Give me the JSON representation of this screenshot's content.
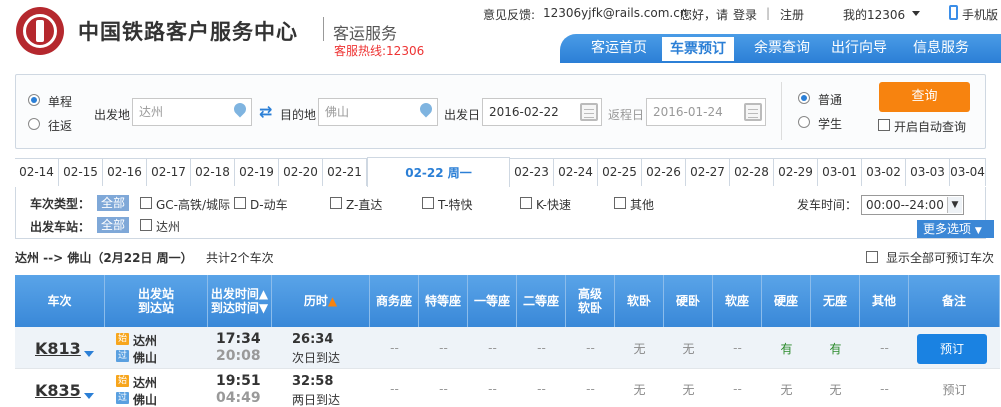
{
  "header": {
    "site_title": "中国铁路客户服务中心",
    "site_subtitle": "客运服务",
    "hotline": "客服热线:12306",
    "feedback_label": "意见反馈:",
    "feedback_email": "12306yjfk@rails.com.cn",
    "greeting": "您好，请",
    "login": "登录",
    "divider": "|",
    "register": "注册",
    "my12306": "我的12306",
    "mobile": "手机版"
  },
  "nav": [
    "客运首页",
    "车票预订",
    "余票查询",
    "出行向导",
    "信息服务"
  ],
  "nav_active": 1,
  "search": {
    "trip_oneway": "单程",
    "trip_round": "往返",
    "from_label": "出发地",
    "from_value": "达州",
    "to_label": "目的地",
    "to_value": "佛山",
    "depart_label": "出发日",
    "depart_value": "2016-02-22",
    "return_label": "返程日",
    "return_value": "2016-01-24",
    "passenger_normal": "普通",
    "passenger_student": "学生",
    "query_button": "查询",
    "auto_query": "开启自动查询"
  },
  "date_tabs": [
    "02-14",
    "02-15",
    "02-16",
    "02-17",
    "02-18",
    "02-19",
    "02-20",
    "02-21",
    "02-22 周一",
    "02-23",
    "02-24",
    "02-25",
    "02-26",
    "02-27",
    "02-28",
    "02-29",
    "03-01",
    "03-02",
    "03-03",
    "03-04"
  ],
  "date_active": 8,
  "filter": {
    "type_label": "车次类型：",
    "all": "全部",
    "types": [
      "GC-高铁/城际",
      "D-动车",
      "Z-直达",
      "T-特快",
      "K-快速",
      "其他"
    ],
    "station_label": "出发车站：",
    "stations": [
      "达州"
    ],
    "time_label": "发车时间：",
    "time_value": "00:00--24:00",
    "more": "更多选项"
  },
  "summary": {
    "route": "达州 --> 佛山（2月22日  周一）",
    "count": "共计2个车次",
    "show_all": "显示全部可预订车次"
  },
  "table": {
    "headers": [
      "车次",
      "出发站\n到达站",
      "出发时间▲\n到达时间▼",
      "历时",
      "商务座",
      "特等座",
      "一等座",
      "二等座",
      "高级\n软卧",
      "软卧",
      "硬卧",
      "软座",
      "硬座",
      "无座",
      "其他",
      "备注"
    ],
    "rows": [
      {
        "train": "K813",
        "from": "达州",
        "to": "佛山",
        "from_badge": "始",
        "to_badge": "过",
        "dep": "17:34",
        "arr": "20:08",
        "dur": "26:34",
        "dur_note": "次日到达",
        "seats": [
          "--",
          "--",
          "--",
          "--",
          "--",
          "无",
          "无",
          "--",
          "有",
          "有",
          "--"
        ],
        "action": "预订",
        "action_enabled": true
      },
      {
        "train": "K835",
        "from": "达州",
        "to": "佛山",
        "from_badge": "始",
        "to_badge": "过",
        "dep": "19:51",
        "arr": "04:49",
        "dur": "32:58",
        "dur_note": "两日到达",
        "seats": [
          "--",
          "--",
          "--",
          "--",
          "--",
          "无",
          "无",
          "--",
          "无",
          "无",
          "--"
        ],
        "action": "预订",
        "action_enabled": false
      }
    ]
  }
}
